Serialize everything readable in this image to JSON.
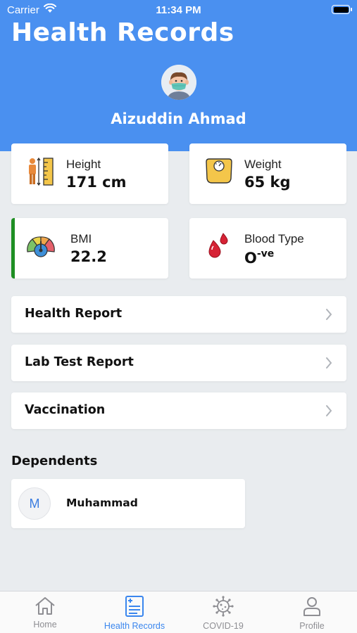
{
  "status_bar": {
    "carrier": "Carrier",
    "time": "11:34 PM"
  },
  "header": {
    "title": "Health Records",
    "user_name": "Aizuddin Ahmad",
    "bg_color": "#4a90f0"
  },
  "stats": [
    {
      "label": "Height",
      "value": "171 cm",
      "icon": "height-ruler-icon"
    },
    {
      "label": "Weight",
      "value": "65 kg",
      "icon": "weighing-scale-icon"
    },
    {
      "label": "BMI",
      "value": "22.2",
      "icon": "bmi-gauge-icon",
      "accent_color": "#1e8e22"
    },
    {
      "label": "Blood Type",
      "value": "O",
      "value_superscript": "-ve",
      "icon": "blood-drop-icon"
    }
  ],
  "menu": [
    {
      "label": "Health Report"
    },
    {
      "label": "Lab Test Report"
    },
    {
      "label": "Vaccination"
    }
  ],
  "dependents": {
    "title": "Dependents",
    "items": [
      {
        "initial": "M",
        "name": "Muhammad"
      }
    ]
  },
  "tabs": [
    {
      "label": "Home",
      "icon": "home-icon",
      "active": false
    },
    {
      "label": "Health Records",
      "icon": "health-records-icon",
      "active": true
    },
    {
      "label": "COVID-19",
      "icon": "virus-icon",
      "active": false
    },
    {
      "label": "Profile",
      "icon": "profile-icon",
      "active": false
    }
  ],
  "colors": {
    "accent": "#3a86ee",
    "inactive_tab": "#8e8e93",
    "background": "#e9ecef"
  }
}
